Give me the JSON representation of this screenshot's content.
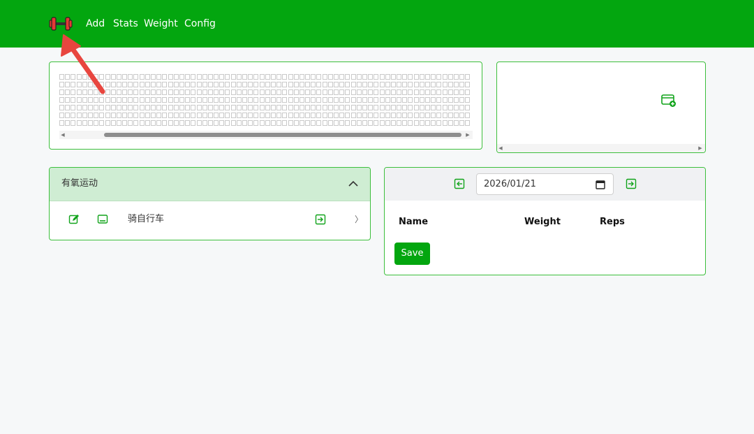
{
  "nav": {
    "logo_icon": "dumbbell-icon",
    "links": [
      "Add",
      "Stats",
      "Weight",
      "Config"
    ]
  },
  "colors": {
    "brand_green": "#03a60f",
    "border_green": "#3cbf3c",
    "accordion_bg": "#cfedd3",
    "annotation_red": "#e8463f"
  },
  "side_panel": {
    "icon": "add-chart-icon"
  },
  "accordion": {
    "title": "有氧运动",
    "expanded": true,
    "items": [
      {
        "name": "骑自行车",
        "icons": [
          "edit-icon",
          "display-icon",
          "log-in-icon",
          "chevron-right-icon"
        ]
      }
    ]
  },
  "log": {
    "date": "2026/01/21",
    "columns": [
      "Name",
      "Weight",
      "Reps"
    ],
    "save_label": "Save"
  }
}
